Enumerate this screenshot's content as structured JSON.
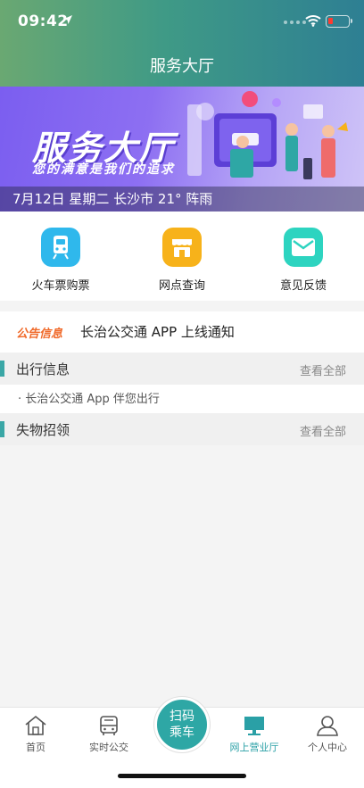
{
  "status": {
    "time": "09:42"
  },
  "header": {
    "title": "服务大厅"
  },
  "banner": {
    "title": "服务大厅",
    "subtitle": "您的满意是我们的追求",
    "info": "7月12日 星期二 长沙市 21° 阵雨"
  },
  "services": [
    {
      "label": "火车票购票",
      "icon": "train-icon",
      "color": "#2fb8ec"
    },
    {
      "label": "网点查询",
      "icon": "shop-icon",
      "color": "#f7b21a"
    },
    {
      "label": "意见反馈",
      "icon": "mail-icon",
      "color": "#2dd4c0"
    }
  ],
  "notice": {
    "tag": "公告信息",
    "text": "长治公交通 APP 上线通知"
  },
  "sections": {
    "travel": {
      "title": "出行信息",
      "more": "查看全部",
      "items": [
        "长治公交通 App 伴您出行"
      ]
    },
    "lost": {
      "title": "失物招领",
      "more": "查看全部"
    }
  },
  "tabbar": {
    "items": [
      {
        "label": "首页",
        "icon": "home-icon"
      },
      {
        "label": "实时公交",
        "icon": "bus-icon"
      },
      {
        "label": "网上营业厅",
        "icon": "monitor-icon",
        "active": true
      },
      {
        "label": "个人中心",
        "icon": "person-icon"
      }
    ],
    "scan": {
      "line1": "扫码",
      "line2": "乘车"
    }
  },
  "colors": {
    "accent": "#2ea7a5",
    "notice_tag": "#f06a2a"
  }
}
